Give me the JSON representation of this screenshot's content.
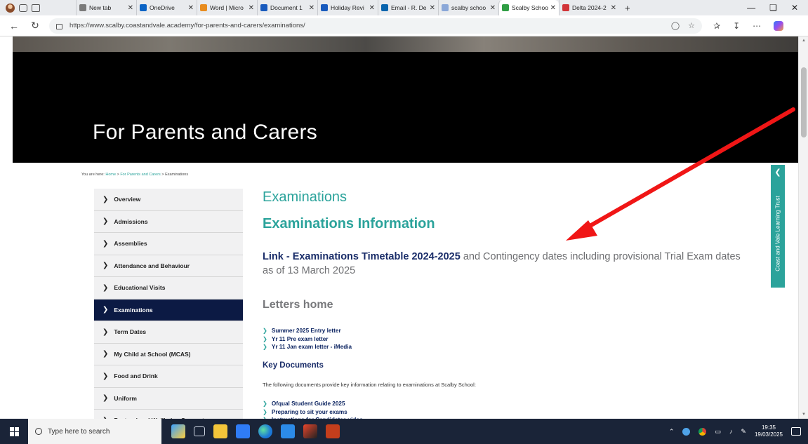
{
  "browser": {
    "tabs": [
      {
        "label": "New tab",
        "color": "#7a7a7a"
      },
      {
        "label": "OneDrive",
        "color": "#0b63c5"
      },
      {
        "label": "Word | Micro",
        "color": "#e88c1e"
      },
      {
        "label": "Document 1",
        "color": "#185abd"
      },
      {
        "label": "Holiday Revi",
        "color": "#185abd"
      },
      {
        "label": "Email - R. De",
        "color": "#0a64ad"
      },
      {
        "label": "scalby schoo",
        "color": "#8aa7d8"
      },
      {
        "label": "Scalby Schoo",
        "color": "#2f9e44"
      },
      {
        "label": "Delta 2024-2",
        "color": "#d13438"
      }
    ],
    "active_tab_index": 7,
    "new_tab_glyph": "+",
    "url": "https://www.scalby.coastandvale.academy/for-parents-and-carers/examinations/"
  },
  "page": {
    "hero_title": "For Parents and Carers",
    "breadcrumb": {
      "prefix": "You are here: ",
      "home": "Home",
      "sep": " > ",
      "parent": "For Parents and Carers",
      "current": "Examinations"
    },
    "sidebar": {
      "items": [
        "Overview",
        "Admissions",
        "Assemblies",
        "Attendance and Behaviour",
        "Educational Visits",
        "Examinations",
        "Term Dates",
        "My Child at School (MCAS)",
        "Food and Drink",
        "Uniform",
        "Pastoral and Wellbeing Support"
      ],
      "active_index": 5
    },
    "heading": "Examinations",
    "subheading": "Examinations Information",
    "lead_link": "Link - Examinations Timetable 2024-2025",
    "lead_rest": " and Contingency dates including provisional Trial Exam dates as of 13 March 2025",
    "letters_heading": "Letters home",
    "letters": [
      "Summer 2025 Entry letter",
      "Yr 11 Pre exam letter",
      "Yr 11 Jan exam letter - iMedia"
    ],
    "key_docs_heading": "Key Documents",
    "key_docs_intro": "The following documents provide key information relating to examinations at Scalby School:",
    "key_docs": [
      "Ofqual Student Guide 2025",
      "Preparing to sit your exams",
      "Instructions for Candidates video"
    ],
    "trust_tab": "Coast and Vale Learning Trust",
    "accent": "#2ba39b",
    "navy": "#0c1a44"
  },
  "taskbar": {
    "search_placeholder": "Type here to search",
    "time": "19:35",
    "date": "19/03/2025"
  }
}
